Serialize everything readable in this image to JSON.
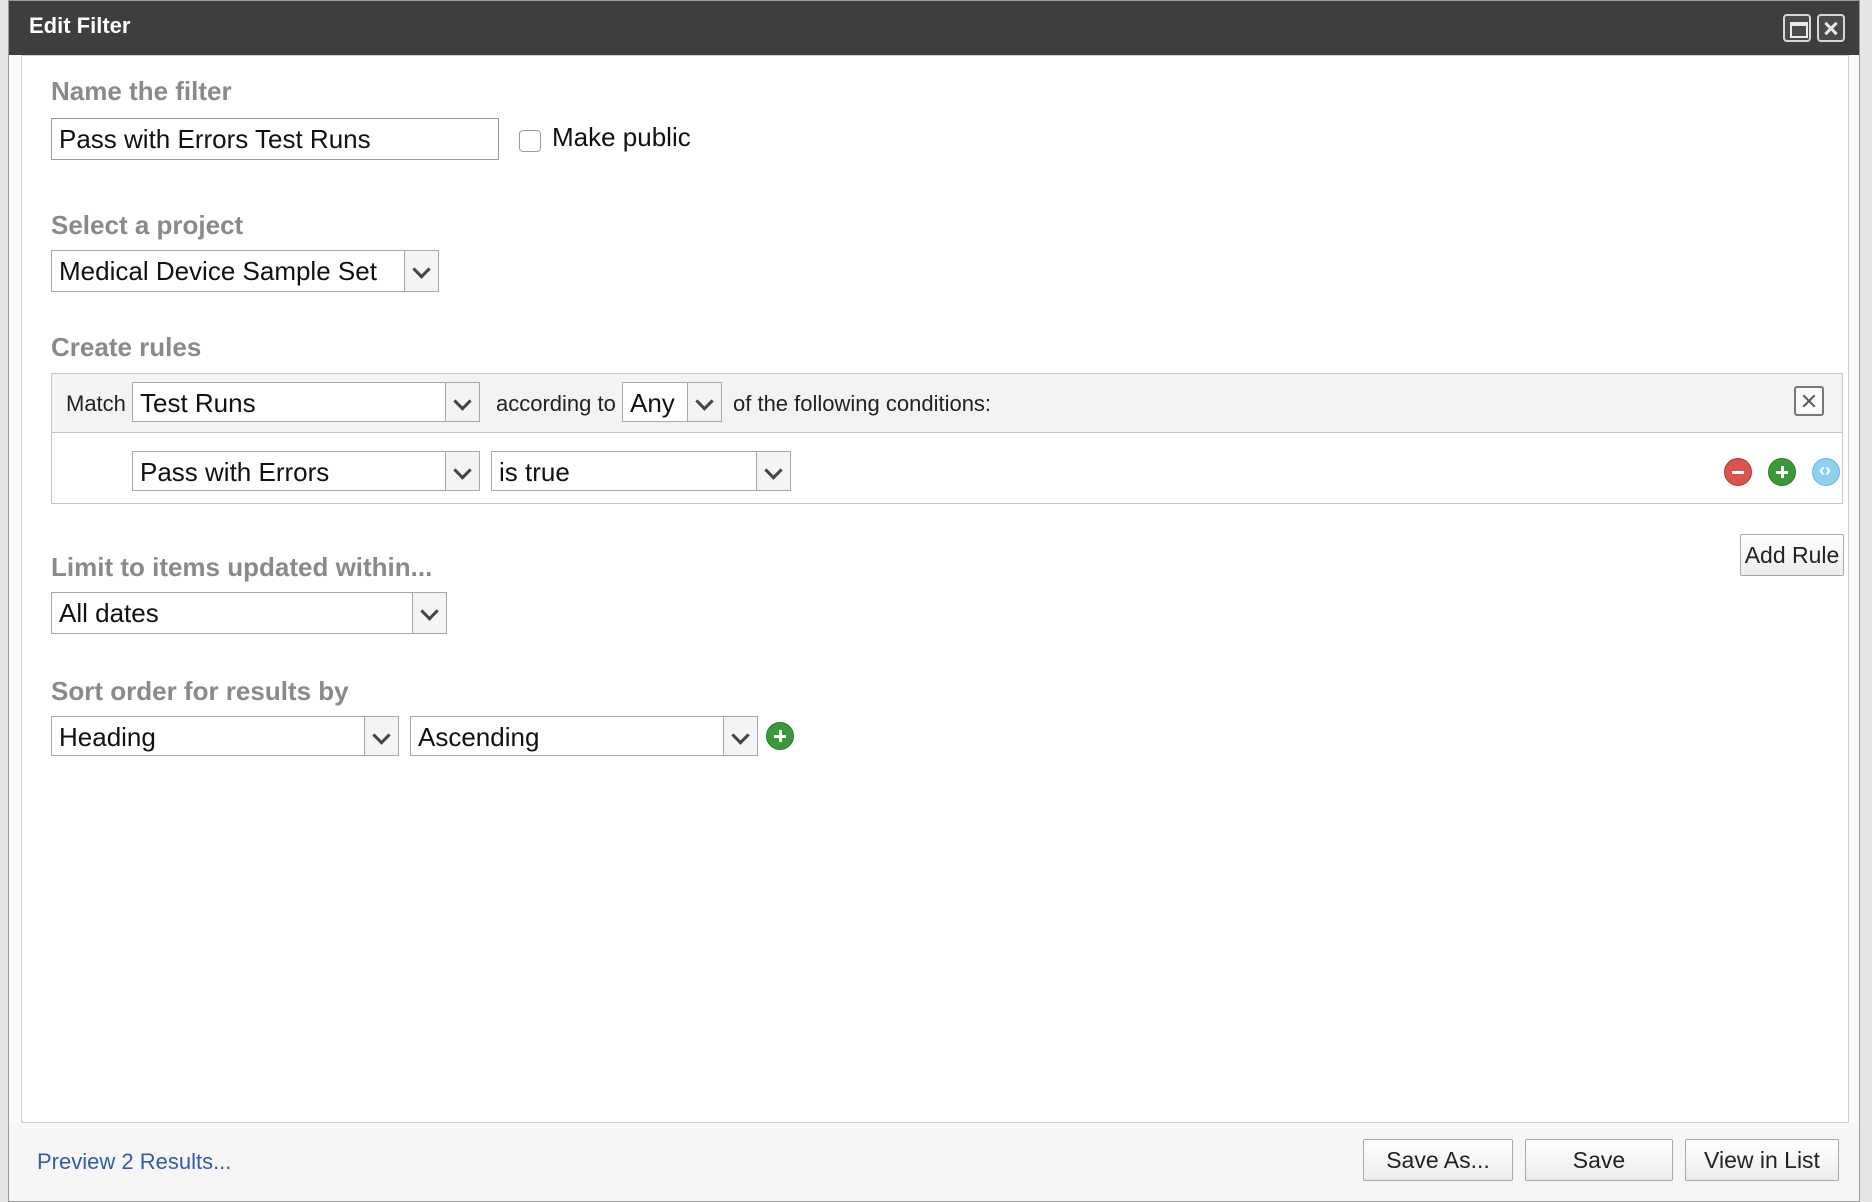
{
  "dialog": {
    "title": "Edit Filter",
    "maximize_icon": "maximize-icon",
    "close_icon": "close-icon"
  },
  "name_section": {
    "label": "Name the filter",
    "value": "Pass with Errors Test Runs",
    "make_public_label": "Make public",
    "make_public_checked": false
  },
  "project_section": {
    "label": "Select a project",
    "selected": "Medical Device Sample Set"
  },
  "rules_section": {
    "label": "Create rules",
    "match_label": "Match",
    "match_value": "Test Runs",
    "according_label": "according to",
    "according_value": "Any",
    "conditions_label": "of the following conditions:",
    "rules": [
      {
        "field": "Pass with Errors",
        "operator": "is true"
      }
    ],
    "add_rule_label": "Add Rule",
    "icon_colors": {
      "remove": "#d9534f",
      "add": "#3a9a3a",
      "code": "#8fd0f0"
    }
  },
  "limit_section": {
    "label": "Limit to items updated within...",
    "selected": "All dates"
  },
  "sort_section": {
    "label": "Sort order for results by",
    "field": "Heading",
    "direction": "Ascending"
  },
  "footer": {
    "preview_link": "Preview 2 Results...",
    "save_as_label": "Save As...",
    "save_label": "Save",
    "view_in_list_label": "View in List"
  }
}
